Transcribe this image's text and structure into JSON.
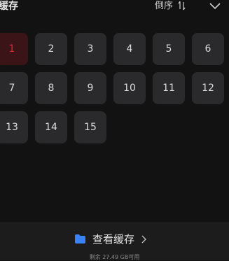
{
  "header": {
    "title": "缓存",
    "sort_label": "倒序",
    "sort_icon": "sort-order-icon",
    "collapse_icon": "chevron-down-icon"
  },
  "episodes": [
    {
      "label": "1",
      "selected": true
    },
    {
      "label": "2",
      "selected": false
    },
    {
      "label": "3",
      "selected": false
    },
    {
      "label": "4",
      "selected": false
    },
    {
      "label": "5",
      "selected": false
    },
    {
      "label": "6",
      "selected": false
    },
    {
      "label": "7",
      "selected": false
    },
    {
      "label": "8",
      "selected": false
    },
    {
      "label": "9",
      "selected": false
    },
    {
      "label": "10",
      "selected": false
    },
    {
      "label": "11",
      "selected": false
    },
    {
      "label": "12",
      "selected": false
    },
    {
      "label": "13",
      "selected": false
    },
    {
      "label": "14",
      "selected": false
    },
    {
      "label": "15",
      "selected": false
    }
  ],
  "footer": {
    "view_cache_label": "查看缓存",
    "storage_text": "剩余 27.49 GB可用",
    "folder_icon": "folder-icon",
    "arrow_icon": "chevron-right-icon"
  },
  "colors": {
    "background": "#121212",
    "tile": "#2a2a2c",
    "selected_tile": "#3a1416",
    "selected_text": "#e0282e",
    "folder": "#3b82f6"
  }
}
